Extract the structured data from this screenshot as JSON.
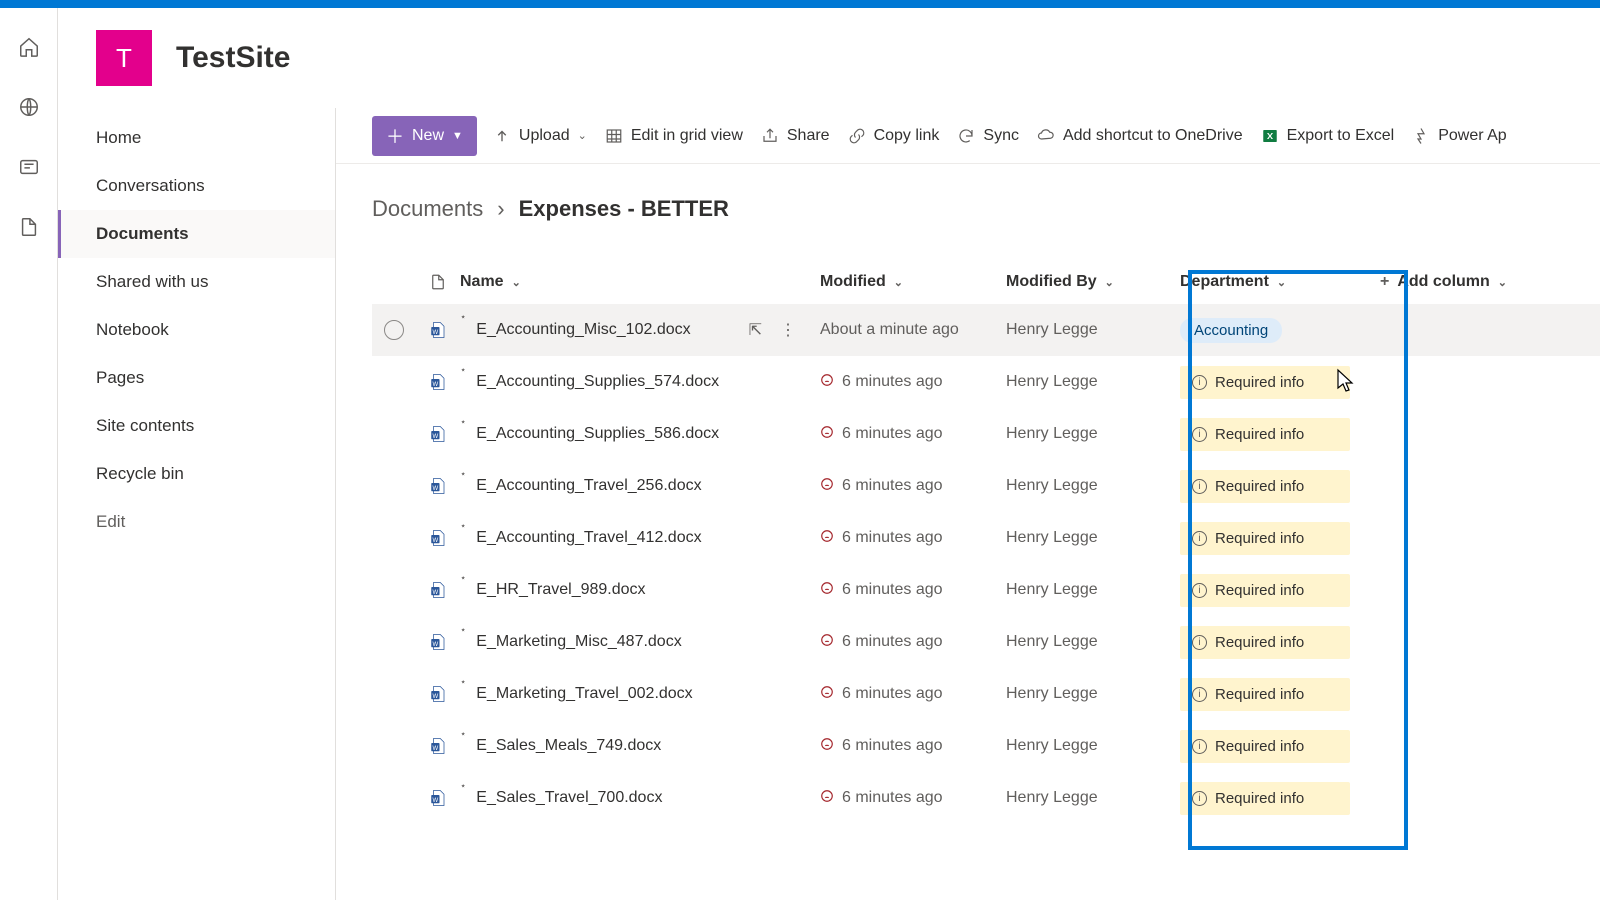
{
  "site": {
    "logo_initial": "T",
    "title": "TestSite"
  },
  "rail": {
    "home": "Home",
    "globe": "Global",
    "news": "News",
    "files": "Files"
  },
  "nav": {
    "items": [
      {
        "label": "Home"
      },
      {
        "label": "Conversations"
      },
      {
        "label": "Documents"
      },
      {
        "label": "Shared with us"
      },
      {
        "label": "Notebook"
      },
      {
        "label": "Pages"
      },
      {
        "label": "Site contents"
      },
      {
        "label": "Recycle bin"
      }
    ],
    "active_index": 2,
    "edit_label": "Edit"
  },
  "toolbar": {
    "new_label": "New",
    "upload_label": "Upload",
    "edit_grid_label": "Edit in grid view",
    "share_label": "Share",
    "copylink_label": "Copy link",
    "sync_label": "Sync",
    "shortcut_label": "Add shortcut to OneDrive",
    "export_label": "Export to Excel",
    "automate_label": "Power Ap"
  },
  "breadcrumb": {
    "root": "Documents",
    "current": "Expenses - BETTER"
  },
  "columns": {
    "name": "Name",
    "modified": "Modified",
    "modified_by": "Modified By",
    "department": "Department",
    "add_column": "Add column"
  },
  "department_values": {
    "accounting": "Accounting",
    "required": "Required info"
  },
  "rows": [
    {
      "name": "E_Accounting_Misc_102.docx",
      "modified": "About a minute ago",
      "modified_by": "Henry Legge",
      "dept": "accounting",
      "hovered": true
    },
    {
      "name": "E_Accounting_Supplies_574.docx",
      "modified": "6 minutes ago",
      "modified_by": "Henry Legge",
      "dept": "required"
    },
    {
      "name": "E_Accounting_Supplies_586.docx",
      "modified": "6 minutes ago",
      "modified_by": "Henry Legge",
      "dept": "required"
    },
    {
      "name": "E_Accounting_Travel_256.docx",
      "modified": "6 minutes ago",
      "modified_by": "Henry Legge",
      "dept": "required"
    },
    {
      "name": "E_Accounting_Travel_412.docx",
      "modified": "6 minutes ago",
      "modified_by": "Henry Legge",
      "dept": "required"
    },
    {
      "name": "E_HR_Travel_989.docx",
      "modified": "6 minutes ago",
      "modified_by": "Henry Legge",
      "dept": "required"
    },
    {
      "name": "E_Marketing_Misc_487.docx",
      "modified": "6 minutes ago",
      "modified_by": "Henry Legge",
      "dept": "required"
    },
    {
      "name": "E_Marketing_Travel_002.docx",
      "modified": "6 minutes ago",
      "modified_by": "Henry Legge",
      "dept": "required"
    },
    {
      "name": "E_Sales_Meals_749.docx",
      "modified": "6 minutes ago",
      "modified_by": "Henry Legge",
      "dept": "required"
    },
    {
      "name": "E_Sales_Travel_700.docx",
      "modified": "6 minutes ago",
      "modified_by": "Henry Legge",
      "dept": "required"
    }
  ]
}
